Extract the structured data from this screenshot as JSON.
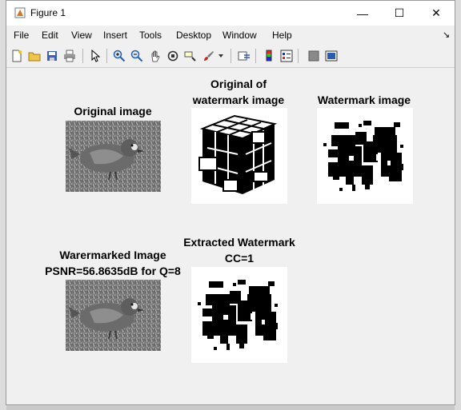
{
  "window": {
    "title": "Figure 1"
  },
  "window_controls": {
    "minimize": "—",
    "maximize": "☐",
    "close": "✕"
  },
  "menu": {
    "file": "File",
    "edit": "Edit",
    "view": "View",
    "insert": "Insert",
    "tools": "Tools",
    "desktop": "Desktop",
    "window": "Window",
    "help": "Help"
  },
  "toolbar_icons": [
    "new-figure-icon",
    "open-file-icon",
    "save-icon",
    "print-icon",
    "pointer-icon",
    "zoom-in-icon",
    "zoom-out-icon",
    "pan-icon",
    "rotate-3d-icon",
    "data-cursor-icon",
    "brush-icon",
    "link-plot-icon",
    "colorbar-icon",
    "legend-icon",
    "hide-plot-tools-icon",
    "show-plot-tools-icon"
  ],
  "figure": {
    "original_image_title": "Original image",
    "original_watermark_title_line1": "Original of",
    "original_watermark_title_line2": "watermark image",
    "watermark_image_title": "Watermark image",
    "watermarked_title_line1": "Warermarked Image",
    "watermarked_title_line2": "PSNR=56.8635dB for Q=8",
    "extracted_title_line1": "Extracted Watermark",
    "extracted_title_line2": "CC=1"
  }
}
